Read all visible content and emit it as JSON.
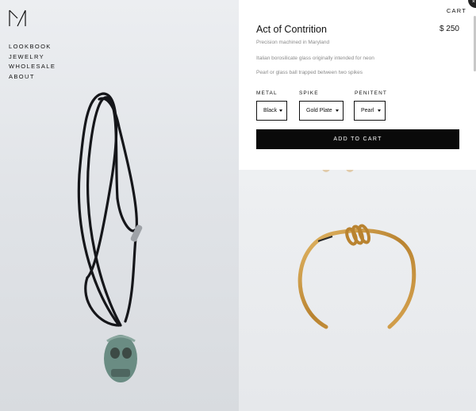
{
  "nav": {
    "items": [
      "LOOKBOOK",
      "JEWELRY",
      "WHOLESALE",
      "ABOUT"
    ]
  },
  "header": {
    "cart_label": "CART"
  },
  "product": {
    "title": "Act of Contrition",
    "price": "$ 250",
    "descriptions": [
      "Precision machined in Maryland",
      "Italian borosilicate glass originally intended for neon",
      "Pearl or glass ball trapped between two spikes"
    ],
    "options": [
      {
        "label": "METAL",
        "selected": "Black"
      },
      {
        "label": "SPIKE",
        "selected": "Gold Plate"
      },
      {
        "label": "PENITENT",
        "selected": "Pearl"
      }
    ],
    "add_to_cart_label": "ADD TO CART"
  },
  "icons": {
    "logo": "brand-logo-icon",
    "corner": "close-icon"
  },
  "colors": {
    "button_bg": "#0a0a0a",
    "photo_bg": "#e3e6e9",
    "gold": "#c9963f",
    "cord": "#15161a"
  }
}
